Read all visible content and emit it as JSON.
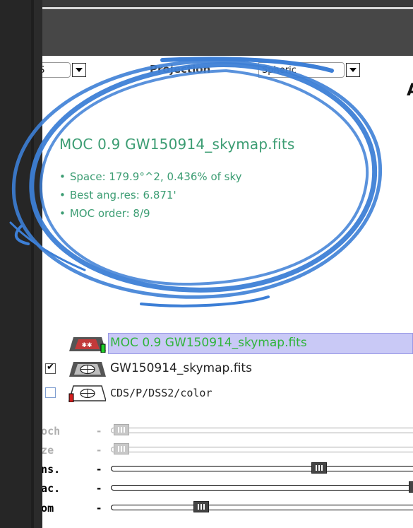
{
  "toolbar": {
    "frame_value": "S",
    "projection_label": "Projection",
    "projection_value": "Spheric",
    "right_text": "A"
  },
  "moc_info": {
    "title": "MOC 0.9 GW150914_skymap.fits",
    "items": [
      "Space: 179.9°^2, 0.436% of sky",
      "Best ang.res: 6.871'",
      "MOC order: 8/9"
    ]
  },
  "layers": [
    {
      "label": "MOC 0.9 GW150914_skymap.fits",
      "selected": true,
      "checked": null
    },
    {
      "label": "GW150914_skymap.fits",
      "selected": false,
      "checked": true
    },
    {
      "label": "CDS/P/DSS2/color",
      "selected": false,
      "checked": false
    }
  ],
  "sliders": [
    {
      "label": "epoch",
      "dash": "-",
      "enabled": false,
      "level": 0.0
    },
    {
      "label": "size",
      "dash": "-",
      "enabled": false,
      "level": 0.0
    },
    {
      "label": "dens.",
      "dash": "-",
      "enabled": true,
      "level": 0.67
    },
    {
      "label": "opac.",
      "dash": "-",
      "enabled": true,
      "level": 1.0
    },
    {
      "label": "zoom",
      "dash": "-",
      "enabled": true,
      "level": 0.27
    }
  ],
  "colors": {
    "moc_green": "#3c9d73",
    "layer_green": "#2fb43a",
    "highlight": "#c9c9f6",
    "annotation_blue": "#3d7fd6"
  }
}
